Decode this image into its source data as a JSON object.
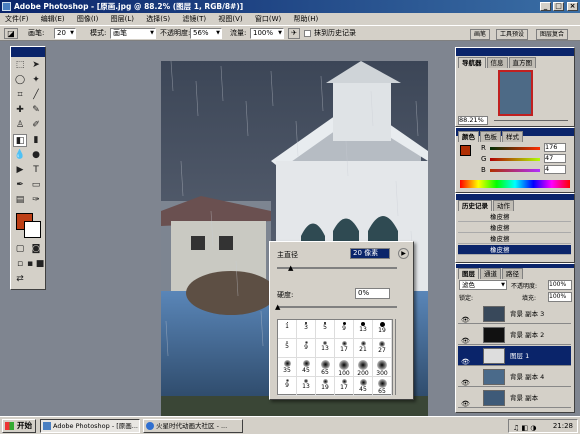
{
  "window": {
    "title": "Adobe Photoshop - [原画.jpg @ 88.2% (图层 1, RGB/8#)]"
  },
  "menu": [
    "文件(F)",
    "编辑(E)",
    "图像(I)",
    "图层(L)",
    "选择(S)",
    "滤镜(T)",
    "视图(V)",
    "窗口(W)",
    "帮助(H)"
  ],
  "options": {
    "brush_label": "画笔:",
    "brush_size": "20",
    "mode_label": "模式:",
    "mode_value": "画笔",
    "opacity_label": "不透明度:",
    "opacity_value": "56%",
    "flow_label": "流量:",
    "flow_value": "100%",
    "history_checkbox_label": "抹到历史记录"
  },
  "palette_well": [
    "画笔",
    "工具预设",
    "图层复合"
  ],
  "brush_popup": {
    "diameter_label": "主直径",
    "diameter_value": "20 像素",
    "hardness_label": "硬度:",
    "hardness_value": "0%",
    "presets": [
      {
        "size": 1,
        "hard": true
      },
      {
        "size": 3,
        "hard": true
      },
      {
        "size": 5,
        "hard": true
      },
      {
        "size": 9,
        "hard": true
      },
      {
        "size": 13,
        "hard": true
      },
      {
        "size": 19,
        "hard": true
      },
      {
        "size": 5,
        "hard": false
      },
      {
        "size": 9,
        "hard": false
      },
      {
        "size": 13,
        "hard": false
      },
      {
        "size": 17,
        "hard": false
      },
      {
        "size": 21,
        "hard": false
      },
      {
        "size": 27,
        "hard": false
      },
      {
        "size": 35,
        "hard": false
      },
      {
        "size": 45,
        "hard": false
      },
      {
        "size": 65,
        "hard": false
      },
      {
        "size": 100,
        "hard": false
      },
      {
        "size": 200,
        "hard": false
      },
      {
        "size": 300,
        "hard": false
      },
      {
        "size": 9,
        "hard": false
      },
      {
        "size": 13,
        "hard": false
      },
      {
        "size": 19,
        "hard": false
      },
      {
        "size": 17,
        "hard": false
      },
      {
        "size": 45,
        "hard": false
      },
      {
        "size": 65,
        "hard": false
      }
    ],
    "grid_numbers": [
      "1",
      "3",
      "5",
      "9",
      "13",
      "19",
      "5",
      "9",
      "13",
      "17",
      "21",
      "27",
      "35",
      "45",
      "65",
      "100",
      "200",
      "300",
      "9",
      "13",
      "19",
      "17",
      "45",
      "65"
    ]
  },
  "navigator": {
    "tabs": [
      "导航器",
      "信息",
      "直方图"
    ],
    "zoom": "88.21%"
  },
  "color": {
    "tabs": [
      "颜色",
      "色板",
      "样式"
    ],
    "r_label": "R",
    "r_value": "176",
    "g_label": "G",
    "g_value": "47",
    "b_label": "B",
    "b_value": "4",
    "fg": "#b02f04"
  },
  "history": {
    "tabs": [
      "历史记录",
      "动作"
    ],
    "items": [
      "橡皮擦",
      "橡皮擦",
      "橡皮擦",
      "橡皮擦"
    ],
    "selected_index": 3
  },
  "layers": {
    "tabs": [
      "图层",
      "通道",
      "路径"
    ],
    "blend_mode": "滤色",
    "opacity_label": "不透明度:",
    "opacity_value": "100%",
    "lock_label": "锁定:",
    "fill_label": "填充:",
    "fill_value": "100%",
    "items": [
      "背景 副本 3",
      "背景 副本 2",
      "图层 1",
      "背景 副本 4",
      "背景 副本"
    ],
    "selected_index": 2
  },
  "taskbar": {
    "start": "开始",
    "tasks": [
      "Adobe Photoshop - [原画...",
      "火星时代动画大社区 - ..."
    ],
    "clock": "21:28"
  }
}
